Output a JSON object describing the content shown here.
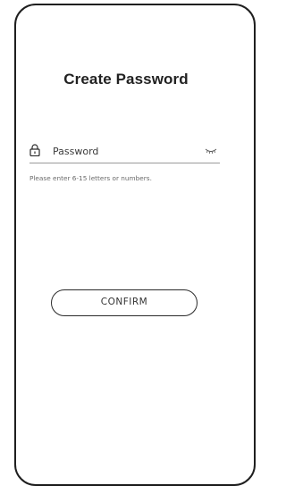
{
  "screen": {
    "title": "Create Password"
  },
  "password_field": {
    "placeholder": "Password",
    "value": "",
    "lock_icon": "lock-icon",
    "visibility_icon": "eye-closed-icon"
  },
  "hint": {
    "text": "Please enter 6-15 letters or numbers."
  },
  "actions": {
    "confirm_label": "CONFIRM"
  }
}
